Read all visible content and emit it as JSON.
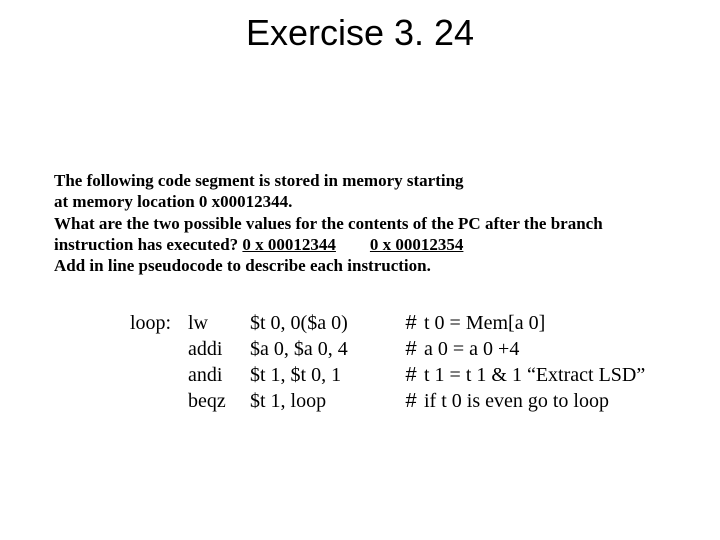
{
  "title": "Exercise 3. 24",
  "intro": {
    "l1": "The following code segment is stored in memory starting",
    "l2": "at memory location  0 x00012344.",
    "l3": "What are the two possible values for the contents of the PC after the branch",
    "l4a": "instruction has executed? ",
    "ans1": "0 x 00012344",
    "gap": "        ",
    "ans2": "0 x 00012354",
    "l5": "Add in line pseudocode to describe each instruction."
  },
  "code": {
    "label": "loop:",
    "rows": [
      {
        "op": "lw",
        "args": "$t 0, 0($a 0)",
        "hash": "#",
        "comment": "t 0 = Mem[a 0]"
      },
      {
        "op": "addi",
        "args": "$a 0, $a 0, 4",
        "hash": "#",
        "comment": "a 0 = a 0 +4"
      },
      {
        "op": "andi",
        "args": "$t 1, $t 0, 1",
        "hash": "#",
        "comment": "t 1 = t 1 & 1 “Extract LSD”"
      },
      {
        "op": "beqz",
        "args": "$t 1,  loop",
        "hash": "#",
        "comment": "if  t 0 is even  go to loop"
      }
    ]
  }
}
